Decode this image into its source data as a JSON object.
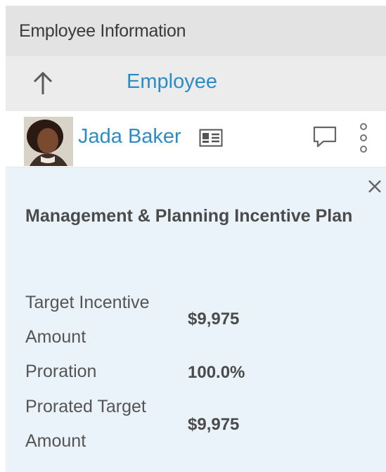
{
  "header": {
    "title": "Employee Information"
  },
  "nav": {
    "title": "Employee"
  },
  "person": {
    "name": "Jada Baker"
  },
  "plan": {
    "title": "Management & Planning Incentive Plan",
    "rows": [
      {
        "label": "Target Incentive Amount",
        "value": "$9,975"
      },
      {
        "label": "Proration",
        "value": "100.0%"
      },
      {
        "label": "Prorated Target Amount",
        "value": "$9,975"
      }
    ]
  },
  "icons": {
    "back": "arrow-up-icon",
    "profile_card": "profile-card-icon",
    "comment": "comment-icon",
    "more": "more-vertical-icon",
    "close": "close-icon"
  },
  "colors": {
    "accent_link": "#2c8cc4",
    "header_bg": "#e3e3e3",
    "nav_bg": "#ececec",
    "panel_bg": "#e9f3f9",
    "text_dark": "#4b4b4b"
  }
}
